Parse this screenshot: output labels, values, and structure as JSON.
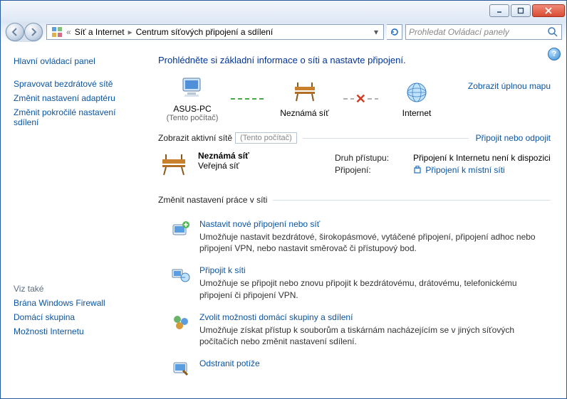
{
  "addressbar": {
    "crumb1": "Síť a Internet",
    "crumb2": "Centrum síťových připojení a sdílení"
  },
  "search": {
    "placeholder": "Prohledat Ovládací panely"
  },
  "sidebar": {
    "home": "Hlavní ovládací panel",
    "links": [
      "Spravovat bezdrátové sítě",
      "Změnit nastavení adaptéru",
      "Změnit pokročilé nastavení sdílení"
    ],
    "seealso_label": "Viz také",
    "seealso": [
      "Brána Windows Firewall",
      "Domácí skupina",
      "Možnosti Internetu"
    ]
  },
  "content": {
    "heading": "Prohlédněte si základní informace o síti a nastavte připojení.",
    "full_map_link": "Zobrazit úplnou mapu",
    "map": {
      "node1": "ASUS-PC",
      "node1_sub": "(Tento počítač)",
      "node2": "Neznámá síť",
      "node3": "Internet"
    },
    "active_title": "Zobrazit aktivní sítě",
    "active_tooltip": "(Tento počítač)",
    "connect_link": "Připojit nebo odpojit",
    "active_net": {
      "name": "Neznámá síť",
      "type": "Veřejná síť",
      "access_k": "Druh přístupu:",
      "access_v": "Připojení k Internetu není k dispozici",
      "conn_k": "Připojení:",
      "conn_v": "Připojení k místní síti"
    },
    "change_title": "Změnit nastavení práce v síti",
    "tasks": [
      {
        "title": "Nastavit nové připojení nebo síť",
        "desc": "Umožňuje nastavit bezdrátové, širokopásmové, vytáčené připojení, připojení adhoc nebo připojení VPN, nebo nastavit směrovač či přístupový bod."
      },
      {
        "title": "Připojit k síti",
        "desc": "Umožňuje se připojit nebo znovu připojit k bezdrátovému, drátovému, telefonickému připojení či připojení VPN."
      },
      {
        "title": "Zvolit možnosti domácí skupiny a sdílení",
        "desc": "Umožňuje získat přístup k souborům a tiskárnám nacházejícím se v jiných síťových počítačích nebo změnit nastavení sdílení."
      },
      {
        "title": "Odstranit potíže",
        "desc": ""
      }
    ]
  }
}
